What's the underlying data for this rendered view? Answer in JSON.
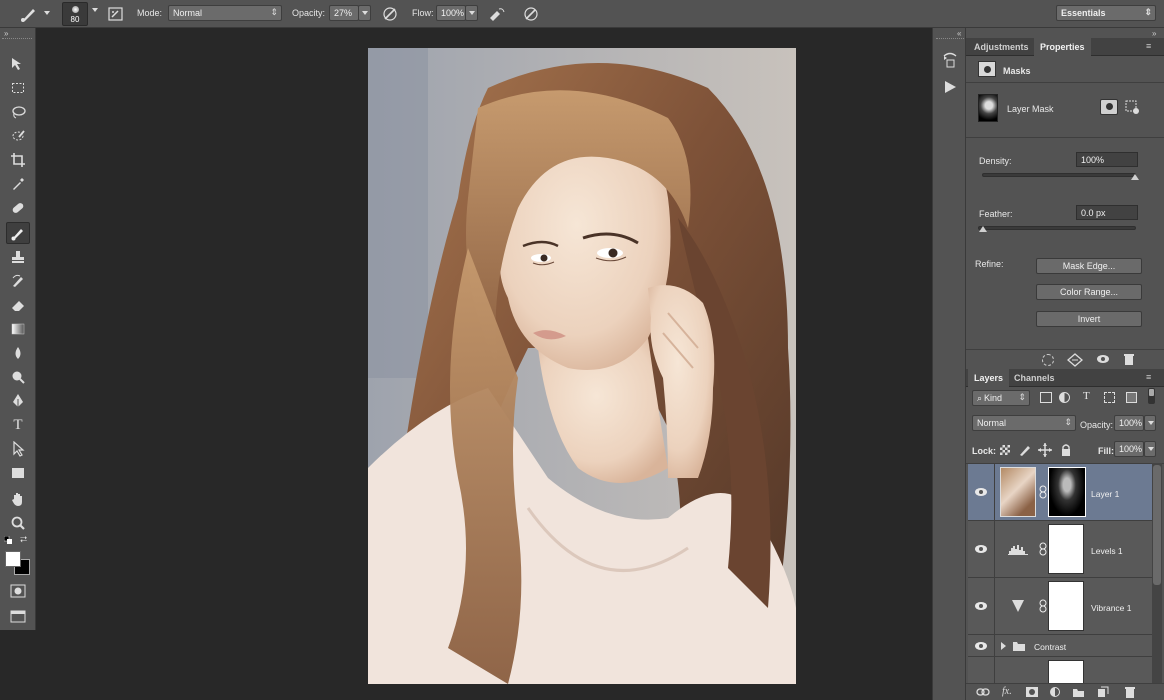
{
  "options_bar": {
    "brush_size": "80",
    "mode_label": "Mode:",
    "mode_value": "Normal",
    "opacity_label": "Opacity:",
    "opacity_value": "27%",
    "flow_label": "Flow:",
    "flow_value": "100%",
    "workspace": "Essentials"
  },
  "toolbar": {
    "tools": [
      "move",
      "marquee",
      "lasso",
      "quick-selection",
      "crop",
      "eyedropper",
      "healing-brush",
      "brush",
      "clone-stamp",
      "history-brush",
      "eraser",
      "gradient",
      "blur",
      "dodge",
      "pen",
      "type",
      "path-selection",
      "rectangle",
      "hand",
      "zoom"
    ],
    "active_tool": "brush",
    "type_glyph": "T"
  },
  "properties_panel": {
    "tabs": [
      "Adjustments",
      "Properties"
    ],
    "active_tab": "Properties",
    "masks_title": "Masks",
    "layer_mask_label": "Layer Mask",
    "density_label": "Density:",
    "density_value": "100%",
    "density_level": 1.0,
    "feather_label": "Feather:",
    "feather_value": "0.0 px",
    "feather_level": 0.0,
    "refine_label": "Refine:",
    "buttons": [
      "Mask Edge...",
      "Color Range...",
      "Invert"
    ]
  },
  "layers_panel": {
    "tabs": [
      "Layers",
      "Channels"
    ],
    "active_tab": "Layers",
    "filter_kind": "Kind",
    "blend_mode": "Normal",
    "opacity_label": "Opacity:",
    "opacity_value": "100%",
    "lock_label": "Lock:",
    "fill_label": "Fill:",
    "fill_value": "100%",
    "layers": [
      {
        "name": "Layer 1",
        "selected": true,
        "kind": "pixel-with-mask"
      },
      {
        "name": "Levels 1",
        "selected": false,
        "kind": "levels-adjustment"
      },
      {
        "name": "Vibrance 1",
        "selected": false,
        "kind": "vibrance-adjustment"
      },
      {
        "name": "Contrast",
        "selected": false,
        "kind": "group"
      }
    ]
  },
  "colors": {
    "panel_bg": "#535353",
    "app_bg": "#282828",
    "selection": "#6c7a92"
  }
}
